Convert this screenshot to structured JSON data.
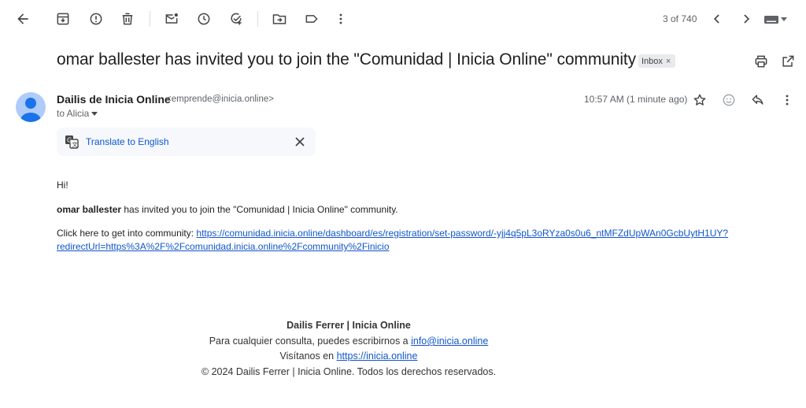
{
  "toolbar": {
    "back_icon": "arrow-left-icon",
    "actions": [
      "archive-icon",
      "report-spam-icon",
      "delete-icon",
      "mark-unread-icon",
      "snooze-icon",
      "add-to-tasks-icon",
      "move-to-icon",
      "label-icon",
      "more-vert-icon"
    ],
    "page_count": "3 of 740",
    "nav": [
      "chevron-left-icon",
      "chevron-right-icon",
      "keyboard-icon"
    ]
  },
  "email": {
    "subject": "omar ballester has invited you to join the \"Comunidad | Inicia Online\" community",
    "label_chip": "Inbox",
    "sender_name": "Dailis de Inicia Online",
    "sender_email": "<emprende@inicia.online>",
    "to_line": "to Alicia",
    "timestamp": "10:57 AM (1 minute ago)",
    "translate_label": "Translate to English",
    "greeting": "Hi!",
    "inviter_name": "omar ballester",
    "invite_text": " has invited you to join the \"Comunidad | Inicia Online\" community.",
    "click_text": "Click here to get into community: ",
    "link_line1": "https://comunidad.inicia.online/dashboard/es/registration/set-password/-yjj4q5pL3oRYza0s0u6_ntMFZdUpWAn0GcbUytH1UY?",
    "link_line2": "redirectUrl=https%3A%2F%2Fcomunidad.inicia.online%2Fcommunity%2Finicio"
  },
  "footer": {
    "company": "Dailis Ferrer | Inicia Online",
    "contact_text": "Para cualquier consulta, puedes escribirnos a ",
    "contact_email": "info@inicia.online",
    "visit_text": "Visítanos en ",
    "visit_link": "https://inicia.online",
    "copyright": "© 2024 Dailis Ferrer | Inicia Online. Todos los derechos reservados."
  },
  "colors": {
    "link": "#1155cc",
    "translate_link": "#0b57d0",
    "icon": "#444746",
    "chip_bg": "#e8eaed"
  }
}
